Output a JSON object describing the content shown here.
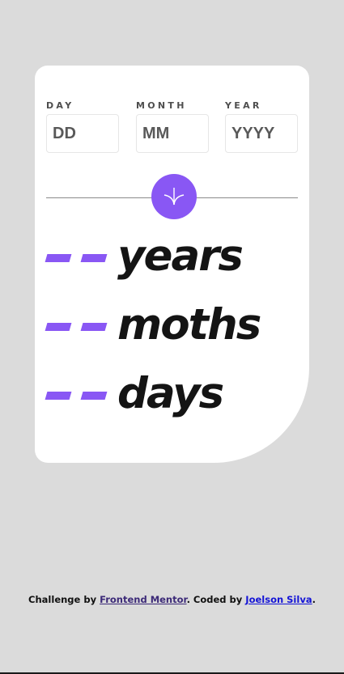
{
  "form": {
    "day": {
      "label": "DAY",
      "placeholder": "DD",
      "value": ""
    },
    "month": {
      "label": "MONTH",
      "placeholder": "MM",
      "value": ""
    },
    "year": {
      "label": "YEAR",
      "placeholder": "YYYY",
      "value": ""
    },
    "submit_icon": "arrow-down-icon"
  },
  "results": [
    {
      "value": "- -",
      "unit": "years"
    },
    {
      "value": "- -",
      "unit": "moths"
    },
    {
      "value": "- -",
      "unit": "days"
    }
  ],
  "footer": {
    "prefix": "Challenge by",
    "link1": "Frontend Mentor",
    "middle": ". Coded by",
    "link2": "Joelson Silva",
    "suffix": "."
  },
  "colors": {
    "accent": "#8957f4",
    "background": "#dbdbdb",
    "card": "#ffffff",
    "text": "#141414"
  }
}
